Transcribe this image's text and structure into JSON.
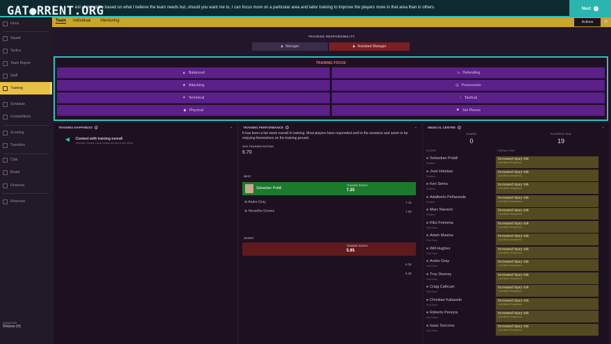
{
  "banner": {
    "watermark": "GAT●RRENT.ORG",
    "message": "est of my ability based on what I believe the team needs but, should you want me to, I can focus more on a particular area and tailor training to improve the players more in that area than in others.",
    "next_label": "Next"
  },
  "sidebar": {
    "items": [
      {
        "label": "Inbox"
      },
      {
        "label": "Squad"
      },
      {
        "label": "Tactics"
      },
      {
        "label": "Team Report"
      },
      {
        "label": "Staff"
      },
      {
        "label": "Training"
      },
      {
        "label": "Schedule"
      },
      {
        "label": "Competitions"
      },
      {
        "label": "Scouting"
      },
      {
        "label": "Transfers"
      },
      {
        "label": "Club"
      },
      {
        "label": "Board"
      },
      {
        "label": "Finances"
      },
      {
        "label": "Reserves"
      }
    ],
    "manager_label": "MANAGER",
    "manager_name": "Widzew (H)"
  },
  "tabs": [
    "Team",
    "Individual",
    "Mentoring"
  ],
  "actions_label": "Actions",
  "responsibility": {
    "title": "TRAINING RESPONSIBILITY",
    "manager": "Manager",
    "assistant": "Assistant Manager"
  },
  "focus": {
    "title": "TRAINING FOCUS",
    "buttons": [
      {
        "label": "Balanced",
        "icon": "balance-icon",
        "glyph": "▲"
      },
      {
        "label": "Defending",
        "icon": "boot-icon",
        "glyph": "↘"
      },
      {
        "label": "Attacking",
        "icon": "running-icon",
        "glyph": "★"
      },
      {
        "label": "Possession",
        "icon": "target-icon",
        "glyph": "◎"
      },
      {
        "label": "Technical",
        "icon": "dribble-icon",
        "glyph": "✦"
      },
      {
        "label": "Tactical",
        "icon": "tactics-icon",
        "glyph": "↑"
      },
      {
        "label": "Physical",
        "icon": "dumbbell-icon",
        "glyph": "◆"
      },
      {
        "label": "Set Pieces",
        "icon": "flag-icon",
        "glyph": "⚑"
      }
    ]
  },
  "happiness": {
    "title": "TRAINING HAPPINESS",
    "status": "Content with training overall",
    "sub": "Heurelho Gomes, David Jordan and two to the others"
  },
  "performance": {
    "title": "TRAINING PERFORMANCE",
    "text": "It has been a fair week overall in training. Most players have responded well to the sessions and seem to be enjoying themselves on the training ground.",
    "avg_label": "AVG TRAINING RATING",
    "avg_value": "6.70",
    "best_label": "BEST",
    "best_player": "Sebastian Priddl",
    "rating_label": "TRAINING RATING",
    "best_rating": "7.25",
    "best_others": [
      {
        "name": "Andre Gray",
        "value": "7.15"
      },
      {
        "name": "Heurelho Gomes",
        "value": "7.05"
      }
    ],
    "worst_label": "WORST",
    "worst_rating": "5.95",
    "worst_others": [
      {
        "value": "6.35"
      },
      {
        "value": "6.35"
      }
    ]
  },
  "medical": {
    "title": "MEDICAL CENTRE",
    "injured_label": "INJURED",
    "injured_value": "0",
    "risk_label": "PLAYERS AT RISK",
    "risk_value": "19",
    "players_col": "PLAYER",
    "overall_col": "OVERALL RISK",
    "risk_text": "Increased injury risk",
    "risk_sub": "Low Match Sharpness",
    "rows": [
      {
        "name": "Sebastian Priddl",
        "pos": "Rotation"
      },
      {
        "name": "José Holebas",
        "pos": "Rotation"
      },
      {
        "name": "Ken Sema",
        "pos": "Rotation"
      },
      {
        "name": "Adalberto Peñaranda",
        "pos": "Rotation"
      },
      {
        "name": "Marc Navarro",
        "pos": "Rotation"
      },
      {
        "name": "Kiko Femenia",
        "pos": "First Team"
      },
      {
        "name": "Adam Masina",
        "pos": "First Team"
      },
      {
        "name": "Will Hughes",
        "pos": "First Team"
      },
      {
        "name": "Andre Gray",
        "pos": "First Team"
      },
      {
        "name": "Troy Deeney",
        "pos": "First Team"
      },
      {
        "name": "Craig Cathcart",
        "pos": "First Team"
      },
      {
        "name": "Christian Kabasele",
        "pos": "First Team"
      },
      {
        "name": "Roberto Pereyra",
        "pos": "Key Player"
      },
      {
        "name": "Isaac Success",
        "pos": "First Team"
      }
    ]
  }
}
